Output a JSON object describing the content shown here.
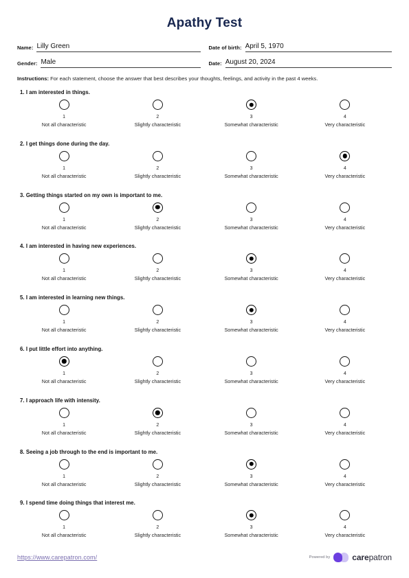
{
  "document": {
    "title": "Apathy Test"
  },
  "fields": [
    {
      "label": "Name:",
      "value": "Lilly Green"
    },
    {
      "label": "Date of birth:",
      "value": "April 5, 1970"
    },
    {
      "label": "Gender:",
      "value": "Male"
    },
    {
      "label": "Date:",
      "value": "August 20, 2024"
    }
  ],
  "instructions": {
    "label": "Instructions:",
    "text": "For each statement, choose the answer that best describes your thoughts, feelings, and activity in the past 4 weeks."
  },
  "scale": [
    {
      "number": "1",
      "label": "Not all characteristic"
    },
    {
      "number": "2",
      "label": "Slightly characteristic"
    },
    {
      "number": "3",
      "label": "Somewhat characteristic"
    },
    {
      "number": "4",
      "label": "Very characteristic"
    }
  ],
  "questions": [
    {
      "text": "1. I am interested in things.",
      "selected": 3
    },
    {
      "text": "2. I get things done during the day.",
      "selected": 4
    },
    {
      "text": "3. Getting things started on my own is important to me.",
      "selected": 2
    },
    {
      "text": "4. I am interested in having new experiences.",
      "selected": 3
    },
    {
      "text": "5. I am interested in learning new things.",
      "selected": 3
    },
    {
      "text": "6. I put little effort into anything.",
      "selected": 1
    },
    {
      "text": "7. I approach life with intensity.",
      "selected": 2
    },
    {
      "text": "8. Seeing a job through to the end is important to me.",
      "selected": 3
    },
    {
      "text": "9. I spend time doing things that interest me.",
      "selected": 3
    }
  ],
  "footer": {
    "url": "https://www.carepatron.com/",
    "powered_by": "Powered by",
    "brand_bold": "care",
    "brand_light": "patron"
  },
  "colors": {
    "title": "#17264f",
    "link": "#7b6fb0",
    "brand_dark": "#6c3fe0",
    "brand_light": "#cfc4f5",
    "text": "#1b1b1b"
  }
}
